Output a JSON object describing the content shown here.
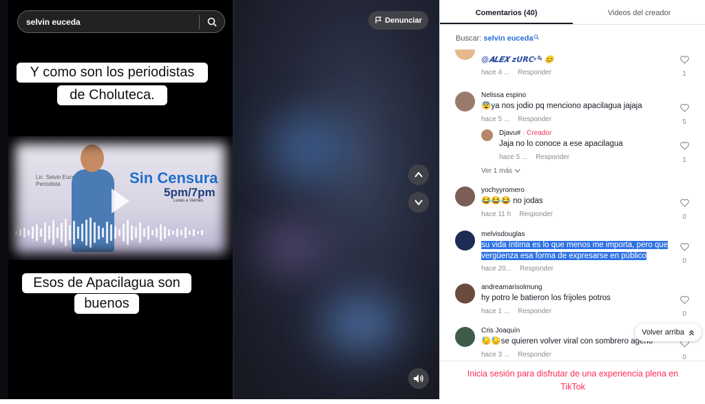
{
  "search": {
    "query": "selvin euceda"
  },
  "report_label": "Denunciar",
  "video": {
    "caption_top_line1": "Y como son los periodistas",
    "caption_top_line2": "de Choluteca.",
    "caption_bottom_line1": "Esos de Apacilagua son",
    "caption_bottom_line2": "buenos",
    "banner": {
      "subtitle_line1": "Lic. Selvin Euceda",
      "subtitle_line2": "Periodista",
      "title": "Sin Censura",
      "time": "5pm/7pm",
      "days": "Lunes a Viernes"
    }
  },
  "tabs": [
    {
      "label": "Comentarios (40)",
      "active": true
    },
    {
      "label": "Videos del creador",
      "active": false
    }
  ],
  "panel_search": {
    "label": "Buscar:",
    "query": "selvin euceda"
  },
  "comments": [
    {
      "user": "@𝑨𝑳𝑬𝑿 𝘇𝗨𝗥𝗖⁵⁰⁴ 😊",
      "text": "",
      "time": "hace 4 ...",
      "reply": "Responder",
      "likes": "1",
      "avatar_color": "#e6b98c"
    },
    {
      "user": "Nelissa espino",
      "text": "😨ya nos jodio pq menciono apacilagua jajaja",
      "time": "hace 5 ...",
      "reply": "Responder",
      "likes": "5",
      "avatar_color": "#9a7b6b"
    },
    {
      "user": "Djavu#",
      "creator_tag": "· Creador",
      "text": "Jaja no lo conoce a ese apacilagua",
      "time": "hace 5 ...",
      "reply": "Responder",
      "likes": "1",
      "avatar_color": "#b7866a"
    },
    {
      "user": "yochyyromero",
      "text": "😂😂😂 no jodas",
      "time": "hace 11 h",
      "reply": "Responder",
      "likes": "0",
      "avatar_color": "#7b5e57"
    },
    {
      "user": "melvisdouglas",
      "text": "su vida íntima es lo que menos me importa, pero que vergüenza esa forma de expresarse en público",
      "time": "hace 20...",
      "reply": "Responder",
      "likes": "0",
      "avatar_color": "#1c2c55"
    },
    {
      "user": "andreamarisolmung",
      "text": "hy potro le batieron los frijoles potros",
      "time": "hace 1 ...",
      "reply": "Responder",
      "likes": "0",
      "avatar_color": "#6b4a3e"
    },
    {
      "user": "Cris Joaquín",
      "text": "😓😓se quieren volver viral con sombrero ageno",
      "time": "hace 3 ...",
      "reply": "Responder",
      "likes": "0",
      "avatar_color": "#3f5c4a"
    }
  ],
  "view_more": "Ver 1 más",
  "back_to_top": "Volver arriba",
  "login_prompt": "Inicia sesión para disfrutar de una experiencia plena en TikTok"
}
